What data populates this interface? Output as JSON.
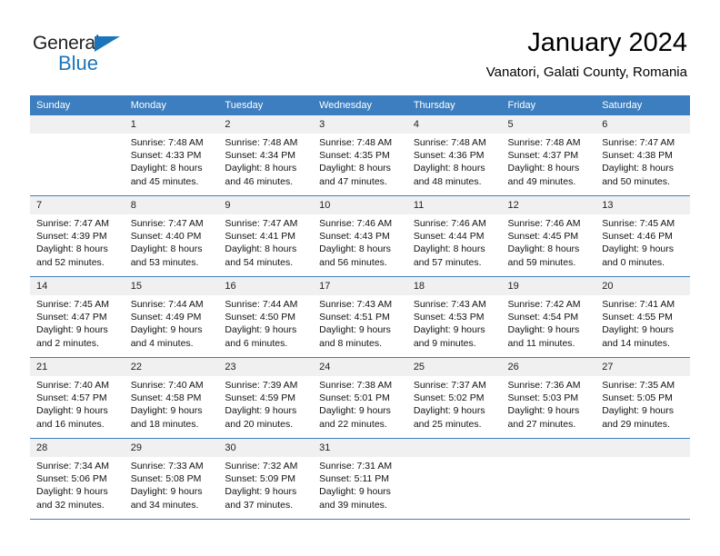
{
  "brand": {
    "logo_text_1": "General",
    "logo_text_2": "Blue",
    "accent_color": "#1b75bb"
  },
  "header": {
    "title": "January 2024",
    "subtitle": "Vanatori, Galati County, Romania"
  },
  "calendar": {
    "header_color": "#3c7ebf",
    "daynum_bg": "#f0f0f0",
    "weekday_headers": [
      "Sunday",
      "Monday",
      "Tuesday",
      "Wednesday",
      "Thursday",
      "Friday",
      "Saturday"
    ],
    "weeks": [
      [
        {
          "day": "",
          "sunrise": "",
          "sunset": "",
          "daylight_1": "",
          "daylight_2": ""
        },
        {
          "day": "1",
          "sunrise": "Sunrise: 7:48 AM",
          "sunset": "Sunset: 4:33 PM",
          "daylight_1": "Daylight: 8 hours",
          "daylight_2": "and 45 minutes."
        },
        {
          "day": "2",
          "sunrise": "Sunrise: 7:48 AM",
          "sunset": "Sunset: 4:34 PM",
          "daylight_1": "Daylight: 8 hours",
          "daylight_2": "and 46 minutes."
        },
        {
          "day": "3",
          "sunrise": "Sunrise: 7:48 AM",
          "sunset": "Sunset: 4:35 PM",
          "daylight_1": "Daylight: 8 hours",
          "daylight_2": "and 47 minutes."
        },
        {
          "day": "4",
          "sunrise": "Sunrise: 7:48 AM",
          "sunset": "Sunset: 4:36 PM",
          "daylight_1": "Daylight: 8 hours",
          "daylight_2": "and 48 minutes."
        },
        {
          "day": "5",
          "sunrise": "Sunrise: 7:48 AM",
          "sunset": "Sunset: 4:37 PM",
          "daylight_1": "Daylight: 8 hours",
          "daylight_2": "and 49 minutes."
        },
        {
          "day": "6",
          "sunrise": "Sunrise: 7:47 AM",
          "sunset": "Sunset: 4:38 PM",
          "daylight_1": "Daylight: 8 hours",
          "daylight_2": "and 50 minutes."
        }
      ],
      [
        {
          "day": "7",
          "sunrise": "Sunrise: 7:47 AM",
          "sunset": "Sunset: 4:39 PM",
          "daylight_1": "Daylight: 8 hours",
          "daylight_2": "and 52 minutes."
        },
        {
          "day": "8",
          "sunrise": "Sunrise: 7:47 AM",
          "sunset": "Sunset: 4:40 PM",
          "daylight_1": "Daylight: 8 hours",
          "daylight_2": "and 53 minutes."
        },
        {
          "day": "9",
          "sunrise": "Sunrise: 7:47 AM",
          "sunset": "Sunset: 4:41 PM",
          "daylight_1": "Daylight: 8 hours",
          "daylight_2": "and 54 minutes."
        },
        {
          "day": "10",
          "sunrise": "Sunrise: 7:46 AM",
          "sunset": "Sunset: 4:43 PM",
          "daylight_1": "Daylight: 8 hours",
          "daylight_2": "and 56 minutes."
        },
        {
          "day": "11",
          "sunrise": "Sunrise: 7:46 AM",
          "sunset": "Sunset: 4:44 PM",
          "daylight_1": "Daylight: 8 hours",
          "daylight_2": "and 57 minutes."
        },
        {
          "day": "12",
          "sunrise": "Sunrise: 7:46 AM",
          "sunset": "Sunset: 4:45 PM",
          "daylight_1": "Daylight: 8 hours",
          "daylight_2": "and 59 minutes."
        },
        {
          "day": "13",
          "sunrise": "Sunrise: 7:45 AM",
          "sunset": "Sunset: 4:46 PM",
          "daylight_1": "Daylight: 9 hours",
          "daylight_2": "and 0 minutes."
        }
      ],
      [
        {
          "day": "14",
          "sunrise": "Sunrise: 7:45 AM",
          "sunset": "Sunset: 4:47 PM",
          "daylight_1": "Daylight: 9 hours",
          "daylight_2": "and 2 minutes."
        },
        {
          "day": "15",
          "sunrise": "Sunrise: 7:44 AM",
          "sunset": "Sunset: 4:49 PM",
          "daylight_1": "Daylight: 9 hours",
          "daylight_2": "and 4 minutes."
        },
        {
          "day": "16",
          "sunrise": "Sunrise: 7:44 AM",
          "sunset": "Sunset: 4:50 PM",
          "daylight_1": "Daylight: 9 hours",
          "daylight_2": "and 6 minutes."
        },
        {
          "day": "17",
          "sunrise": "Sunrise: 7:43 AM",
          "sunset": "Sunset: 4:51 PM",
          "daylight_1": "Daylight: 9 hours",
          "daylight_2": "and 8 minutes."
        },
        {
          "day": "18",
          "sunrise": "Sunrise: 7:43 AM",
          "sunset": "Sunset: 4:53 PM",
          "daylight_1": "Daylight: 9 hours",
          "daylight_2": "and 9 minutes."
        },
        {
          "day": "19",
          "sunrise": "Sunrise: 7:42 AM",
          "sunset": "Sunset: 4:54 PM",
          "daylight_1": "Daylight: 9 hours",
          "daylight_2": "and 11 minutes."
        },
        {
          "day": "20",
          "sunrise": "Sunrise: 7:41 AM",
          "sunset": "Sunset: 4:55 PM",
          "daylight_1": "Daylight: 9 hours",
          "daylight_2": "and 14 minutes."
        }
      ],
      [
        {
          "day": "21",
          "sunrise": "Sunrise: 7:40 AM",
          "sunset": "Sunset: 4:57 PM",
          "daylight_1": "Daylight: 9 hours",
          "daylight_2": "and 16 minutes."
        },
        {
          "day": "22",
          "sunrise": "Sunrise: 7:40 AM",
          "sunset": "Sunset: 4:58 PM",
          "daylight_1": "Daylight: 9 hours",
          "daylight_2": "and 18 minutes."
        },
        {
          "day": "23",
          "sunrise": "Sunrise: 7:39 AM",
          "sunset": "Sunset: 4:59 PM",
          "daylight_1": "Daylight: 9 hours",
          "daylight_2": "and 20 minutes."
        },
        {
          "day": "24",
          "sunrise": "Sunrise: 7:38 AM",
          "sunset": "Sunset: 5:01 PM",
          "daylight_1": "Daylight: 9 hours",
          "daylight_2": "and 22 minutes."
        },
        {
          "day": "25",
          "sunrise": "Sunrise: 7:37 AM",
          "sunset": "Sunset: 5:02 PM",
          "daylight_1": "Daylight: 9 hours",
          "daylight_2": "and 25 minutes."
        },
        {
          "day": "26",
          "sunrise": "Sunrise: 7:36 AM",
          "sunset": "Sunset: 5:03 PM",
          "daylight_1": "Daylight: 9 hours",
          "daylight_2": "and 27 minutes."
        },
        {
          "day": "27",
          "sunrise": "Sunrise: 7:35 AM",
          "sunset": "Sunset: 5:05 PM",
          "daylight_1": "Daylight: 9 hours",
          "daylight_2": "and 29 minutes."
        }
      ],
      [
        {
          "day": "28",
          "sunrise": "Sunrise: 7:34 AM",
          "sunset": "Sunset: 5:06 PM",
          "daylight_1": "Daylight: 9 hours",
          "daylight_2": "and 32 minutes."
        },
        {
          "day": "29",
          "sunrise": "Sunrise: 7:33 AM",
          "sunset": "Sunset: 5:08 PM",
          "daylight_1": "Daylight: 9 hours",
          "daylight_2": "and 34 minutes."
        },
        {
          "day": "30",
          "sunrise": "Sunrise: 7:32 AM",
          "sunset": "Sunset: 5:09 PM",
          "daylight_1": "Daylight: 9 hours",
          "daylight_2": "and 37 minutes."
        },
        {
          "day": "31",
          "sunrise": "Sunrise: 7:31 AM",
          "sunset": "Sunset: 5:11 PM",
          "daylight_1": "Daylight: 9 hours",
          "daylight_2": "and 39 minutes."
        },
        {
          "day": "",
          "sunrise": "",
          "sunset": "",
          "daylight_1": "",
          "daylight_2": ""
        },
        {
          "day": "",
          "sunrise": "",
          "sunset": "",
          "daylight_1": "",
          "daylight_2": ""
        },
        {
          "day": "",
          "sunrise": "",
          "sunset": "",
          "daylight_1": "",
          "daylight_2": ""
        }
      ]
    ]
  }
}
